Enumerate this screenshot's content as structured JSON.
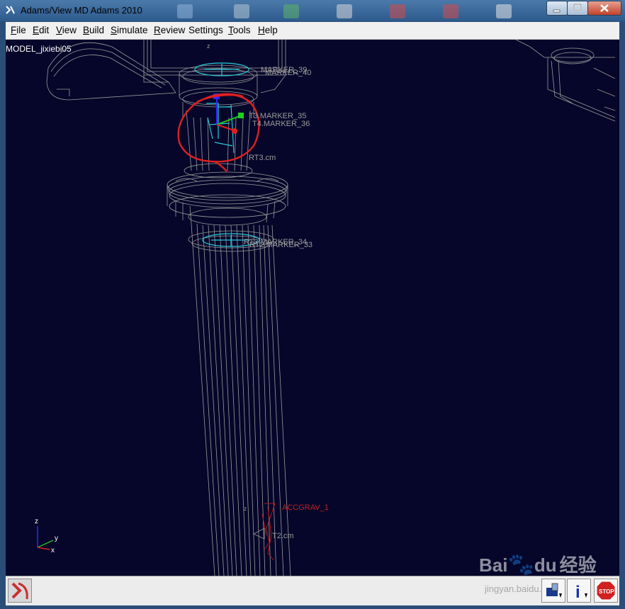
{
  "window": {
    "title": "Adams/View MD Adams 2010"
  },
  "menu": [
    {
      "label": "File",
      "key": "F",
      "rest": "ile"
    },
    {
      "label": "Edit",
      "key": "E",
      "rest": "dit"
    },
    {
      "label": "View",
      "key": "V",
      "rest": "iew"
    },
    {
      "label": "Build",
      "key": "B",
      "rest": "uild"
    },
    {
      "label": "Simulate",
      "key": "S",
      "rest": "imulate"
    },
    {
      "label": "Review",
      "key": "R",
      "rest": "eview"
    },
    {
      "label": "Settings",
      "key": "",
      "rest": "Settings"
    },
    {
      "label": "Tools",
      "key": "T",
      "rest": "ools"
    },
    {
      "label": "Help",
      "key": "H",
      "rest": "elp"
    }
  ],
  "viewport": {
    "model_name": "MODEL_jixiebi05",
    "labels": {
      "marker_39": "MARKER_39",
      "marker_40": "MARKER_40",
      "marker_35": "T3.MARKER_35",
      "marker_36": "T4.MARKER_36",
      "part3_cm": "RT3.cm",
      "marker_34": "RT3.MARKER_34",
      "marker_33": "RT2.MARKER_33",
      "accgrav": "ACCGRAV_1",
      "part2_cm": "T2.cm",
      "z_top": "z"
    },
    "triad": {
      "z": "z",
      "y": "y",
      "x": "x"
    },
    "colors": {
      "background": "#06062a",
      "wireframe": "#9a9a9a",
      "marker": "#27c9d6",
      "annotation": "#e02020",
      "grav": "#b01818"
    }
  },
  "statusbar": {
    "icons": [
      "adams-logo-icon",
      "toolbox-icon",
      "info-icon",
      "stop-icon"
    ],
    "stop_label": "STOP",
    "info_label": "i"
  },
  "watermark": {
    "brand": "Bai",
    "brand2": "du",
    "cn": "经验",
    "url": "jingyan.baidu.com"
  }
}
